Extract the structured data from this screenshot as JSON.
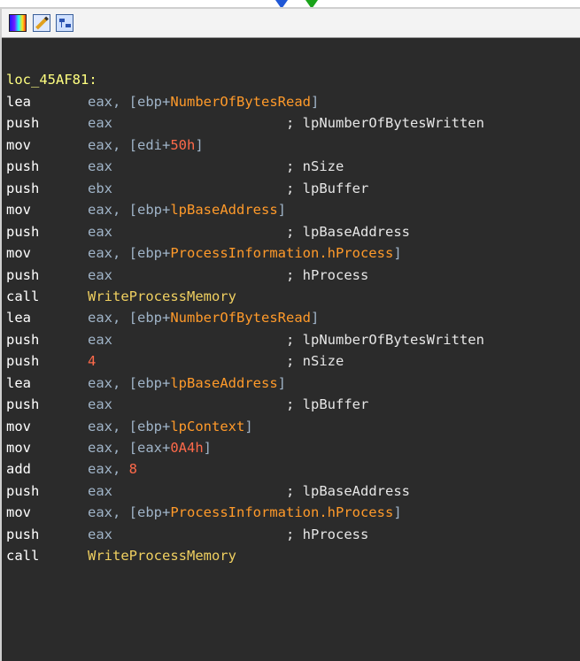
{
  "toolbar": {
    "icons": [
      "palette-icon",
      "edit-node-icon",
      "graph-icon"
    ]
  },
  "code": {
    "label": "loc_45AF81:",
    "lines": [
      {
        "mn": "lea",
        "op": [
          [
            "reg",
            "eax, "
          ],
          [
            "br",
            "["
          ],
          [
            "reg",
            "ebp+"
          ],
          [
            "sym",
            "NumberOfBytesRead"
          ],
          [
            "br",
            "]"
          ]
        ],
        "cm": ""
      },
      {
        "mn": "push",
        "op": [
          [
            "reg",
            "eax"
          ]
        ],
        "cm": "; lpNumberOfBytesWritten"
      },
      {
        "mn": "mov",
        "op": [
          [
            "reg",
            "eax, "
          ],
          [
            "br",
            "["
          ],
          [
            "reg",
            "edi+"
          ],
          [
            "num",
            "50h"
          ],
          [
            "br",
            "]"
          ]
        ],
        "cm": ""
      },
      {
        "mn": "push",
        "op": [
          [
            "reg",
            "eax"
          ]
        ],
        "cm": "; nSize"
      },
      {
        "mn": "push",
        "op": [
          [
            "reg",
            "ebx"
          ]
        ],
        "cm": "; lpBuffer"
      },
      {
        "mn": "mov",
        "op": [
          [
            "reg",
            "eax, "
          ],
          [
            "br",
            "["
          ],
          [
            "reg",
            "ebp+"
          ],
          [
            "sym",
            "lpBaseAddress"
          ],
          [
            "br",
            "]"
          ]
        ],
        "cm": ""
      },
      {
        "mn": "push",
        "op": [
          [
            "reg",
            "eax"
          ]
        ],
        "cm": "; lpBaseAddress"
      },
      {
        "mn": "mov",
        "op": [
          [
            "reg",
            "eax, "
          ],
          [
            "br",
            "["
          ],
          [
            "reg",
            "ebp+"
          ],
          [
            "sym",
            "ProcessInformation.hProcess"
          ],
          [
            "br",
            "]"
          ]
        ],
        "cm": ""
      },
      {
        "mn": "push",
        "op": [
          [
            "reg",
            "eax"
          ]
        ],
        "cm": "; hProcess"
      },
      {
        "mn": "call",
        "op": [
          [
            "api",
            "WriteProcessMemory"
          ]
        ],
        "cm": ""
      },
      {
        "mn": "lea",
        "op": [
          [
            "reg",
            "eax, "
          ],
          [
            "br",
            "["
          ],
          [
            "reg",
            "ebp+"
          ],
          [
            "sym",
            "NumberOfBytesRead"
          ],
          [
            "br",
            "]"
          ]
        ],
        "cm": ""
      },
      {
        "mn": "push",
        "op": [
          [
            "reg",
            "eax"
          ]
        ],
        "cm": "; lpNumberOfBytesWritten"
      },
      {
        "mn": "push",
        "op": [
          [
            "num",
            "4"
          ]
        ],
        "cm": "; nSize"
      },
      {
        "mn": "lea",
        "op": [
          [
            "reg",
            "eax, "
          ],
          [
            "br",
            "["
          ],
          [
            "reg",
            "ebp+"
          ],
          [
            "sym",
            "lpBaseAddress"
          ],
          [
            "br",
            "]"
          ]
        ],
        "cm": ""
      },
      {
        "mn": "push",
        "op": [
          [
            "reg",
            "eax"
          ]
        ],
        "cm": "; lpBuffer"
      },
      {
        "mn": "mov",
        "op": [
          [
            "reg",
            "eax, "
          ],
          [
            "br",
            "["
          ],
          [
            "reg",
            "ebp+"
          ],
          [
            "sym",
            "lpContext"
          ],
          [
            "br",
            "]"
          ]
        ],
        "cm": ""
      },
      {
        "mn": "mov",
        "op": [
          [
            "reg",
            "eax, "
          ],
          [
            "br",
            "["
          ],
          [
            "reg",
            "eax+"
          ],
          [
            "num",
            "0A4h"
          ],
          [
            "br",
            "]"
          ]
        ],
        "cm": ""
      },
      {
        "mn": "add",
        "op": [
          [
            "reg",
            "eax, "
          ],
          [
            "num",
            "8"
          ]
        ],
        "cm": ""
      },
      {
        "mn": "push",
        "op": [
          [
            "reg",
            "eax"
          ]
        ],
        "cm": "; lpBaseAddress"
      },
      {
        "mn": "mov",
        "op": [
          [
            "reg",
            "eax, "
          ],
          [
            "br",
            "["
          ],
          [
            "reg",
            "ebp+"
          ],
          [
            "sym",
            "ProcessInformation.hProcess"
          ],
          [
            "br",
            "]"
          ]
        ],
        "cm": ""
      },
      {
        "mn": "push",
        "op": [
          [
            "reg",
            "eax"
          ]
        ],
        "cm": "; hProcess"
      },
      {
        "mn": "call",
        "op": [
          [
            "api",
            "WriteProcessMemory"
          ]
        ],
        "cm": ""
      }
    ]
  },
  "colors": {
    "background": "#2b2b2b",
    "label": "#ffff80",
    "register": "#a0b4c8",
    "symbol": "#ff9a2a",
    "number": "#ff6a4a",
    "api": "#f0d060",
    "arrow_blue": "#1f57d6",
    "arrow_green": "#1aa31a"
  }
}
